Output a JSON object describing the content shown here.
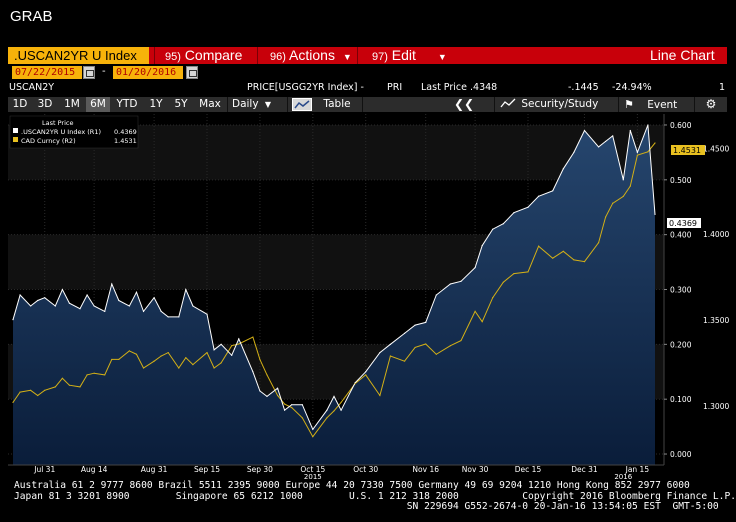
{
  "window": {
    "title": "GRAB"
  },
  "command_bar": {
    "ticker": ".USCAN2YR U Index",
    "compare": {
      "num": "95)",
      "label": "Compare"
    },
    "actions": {
      "num": "96)",
      "label": "Actions"
    },
    "edit": {
      "num": "97)",
      "label": "Edit"
    },
    "view_label": "Line Chart"
  },
  "date_range": {
    "start": "07/22/2015",
    "end": "01/20/2016"
  },
  "info_row": {
    "security": "USCAN2Y",
    "price_field": "PRICE[USGG2YR Index] -",
    "pri": "PRI",
    "last_price": "Last Price .4348",
    "change": "-.1445",
    "change_pct": "-24.94%",
    "page": "1"
  },
  "toolbar": {
    "periods": [
      "1D",
      "3D",
      "1M",
      "6M",
      "YTD",
      "1Y",
      "5Y",
      "Max"
    ],
    "active_period": "6M",
    "frequency": "Daily",
    "table_label": "Table",
    "nav_icon": "double-chevron-left-icon",
    "security_study": "Security/Study",
    "event": "Event",
    "gear_icon": "gear-icon"
  },
  "legend": {
    "header": "Last Price",
    "items": [
      {
        "label": ".USCAN2YR U Index  (R1)",
        "value": "0.4369",
        "color": "#ffffff"
      },
      {
        "label": "CAD Curncy  (R2)",
        "value": "1.4531",
        "color": "#e8c020"
      }
    ]
  },
  "colors": {
    "background": "#000000",
    "area_top": "#26466e",
    "area_bottom": "#0a1d3a",
    "spread_line": "#ffffff",
    "cad_line": "#d4b016",
    "command_bar": "#c8000a",
    "ticker_field": "#f7b20a"
  },
  "chart_data": {
    "type": "line",
    "x_ticks": [
      "Jul 31",
      "Aug 14",
      "Aug 31",
      "Sep 15",
      "Sep 30",
      "Oct 15",
      "Oct 30",
      "Nov 16",
      "Nov 30",
      "Dec 15",
      "Dec 31",
      "Jan 15"
    ],
    "year_labels": [
      "2015",
      "2016"
    ],
    "axis_r1": {
      "ticks": [
        "0.600",
        "0.500",
        "0.400",
        "0.300",
        "0.200",
        "0.100",
        "0.000"
      ],
      "range": [
        -0.02,
        0.62
      ]
    },
    "axis_r2": {
      "ticks": [
        "1.4500",
        "1.4000",
        "1.3500",
        "1.3000"
      ],
      "range": [
        1.2655,
        1.47
      ]
    },
    "last_value_tags": {
      "r1": "0.4369",
      "r2": "1.4531"
    },
    "series": [
      {
        "name": ".USCAN2YR U Index",
        "axis": "R1",
        "x": [
          "2015-07-22",
          "2015-07-24",
          "2015-07-27",
          "2015-07-29",
          "2015-07-31",
          "2015-08-03",
          "2015-08-05",
          "2015-08-07",
          "2015-08-10",
          "2015-08-12",
          "2015-08-14",
          "2015-08-17",
          "2015-08-19",
          "2015-08-21",
          "2015-08-24",
          "2015-08-26",
          "2015-08-28",
          "2015-08-31",
          "2015-09-02",
          "2015-09-04",
          "2015-09-07",
          "2015-09-09",
          "2015-09-11",
          "2015-09-15",
          "2015-09-17",
          "2015-09-19",
          "2015-09-22",
          "2015-09-24",
          "2015-09-28",
          "2015-09-30",
          "2015-10-02",
          "2015-10-05",
          "2015-10-07",
          "2015-10-09",
          "2015-10-12",
          "2015-10-15",
          "2015-10-19",
          "2015-10-21",
          "2015-10-23",
          "2015-10-27",
          "2015-10-30",
          "2015-11-03",
          "2015-11-06",
          "2015-11-10",
          "2015-11-13",
          "2015-11-16",
          "2015-11-19",
          "2015-11-23",
          "2015-11-26",
          "2015-11-30",
          "2015-12-02",
          "2015-12-05",
          "2015-12-08",
          "2015-12-11",
          "2015-12-15",
          "2015-12-18",
          "2015-12-22",
          "2015-12-25",
          "2015-12-28",
          "2015-12-31",
          "2016-01-04",
          "2016-01-06",
          "2016-01-08",
          "2016-01-11",
          "2016-01-13",
          "2016-01-15",
          "2016-01-18",
          "2016-01-20"
        ],
        "values": [
          0.245,
          0.29,
          0.27,
          0.28,
          0.285,
          0.27,
          0.3,
          0.275,
          0.265,
          0.29,
          0.27,
          0.26,
          0.31,
          0.28,
          0.27,
          0.295,
          0.26,
          0.285,
          0.26,
          0.25,
          0.25,
          0.3,
          0.27,
          0.255,
          0.19,
          0.2,
          0.18,
          0.21,
          0.15,
          0.115,
          0.105,
          0.12,
          0.08,
          0.09,
          0.09,
          0.045,
          0.08,
          0.105,
          0.08,
          0.13,
          0.15,
          0.185,
          0.2,
          0.22,
          0.235,
          0.24,
          0.29,
          0.31,
          0.315,
          0.34,
          0.38,
          0.41,
          0.42,
          0.44,
          0.45,
          0.47,
          0.48,
          0.52,
          0.55,
          0.59,
          0.56,
          0.57,
          0.58,
          0.5,
          0.59,
          0.55,
          0.6,
          0.4369
        ]
      },
      {
        "name": "CAD Curncy",
        "axis": "R2",
        "x": [
          "2015-07-22",
          "2015-07-24",
          "2015-07-27",
          "2015-07-29",
          "2015-07-31",
          "2015-08-03",
          "2015-08-05",
          "2015-08-07",
          "2015-08-10",
          "2015-08-12",
          "2015-08-14",
          "2015-08-17",
          "2015-08-19",
          "2015-08-21",
          "2015-08-24",
          "2015-08-26",
          "2015-08-28",
          "2015-08-31",
          "2015-09-02",
          "2015-09-04",
          "2015-09-07",
          "2015-09-09",
          "2015-09-11",
          "2015-09-15",
          "2015-09-17",
          "2015-09-19",
          "2015-09-22",
          "2015-09-24",
          "2015-09-28",
          "2015-09-30",
          "2015-10-02",
          "2015-10-05",
          "2015-10-07",
          "2015-10-09",
          "2015-10-12",
          "2015-10-15",
          "2015-10-19",
          "2015-10-21",
          "2015-10-23",
          "2015-10-27",
          "2015-10-30",
          "2015-11-03",
          "2015-11-06",
          "2015-11-10",
          "2015-11-13",
          "2015-11-16",
          "2015-11-19",
          "2015-11-23",
          "2015-11-26",
          "2015-11-30",
          "2015-12-02",
          "2015-12-05",
          "2015-12-08",
          "2015-12-11",
          "2015-12-15",
          "2015-12-18",
          "2015-12-22",
          "2015-12-25",
          "2015-12-28",
          "2015-12-31",
          "2016-01-04",
          "2016-01-06",
          "2016-01-08",
          "2016-01-11",
          "2016-01-13",
          "2016-01-15",
          "2016-01-18",
          "2016-01-20"
        ],
        "values": [
          1.302,
          1.308,
          1.309,
          1.306,
          1.309,
          1.311,
          1.316,
          1.312,
          1.311,
          1.318,
          1.319,
          1.318,
          1.327,
          1.327,
          1.332,
          1.33,
          1.322,
          1.326,
          1.329,
          1.331,
          1.322,
          1.328,
          1.324,
          1.331,
          1.322,
          1.325,
          1.335,
          1.336,
          1.34,
          1.327,
          1.318,
          1.306,
          1.301,
          1.299,
          1.293,
          1.282,
          1.293,
          1.297,
          1.302,
          1.313,
          1.318,
          1.306,
          1.329,
          1.326,
          1.334,
          1.336,
          1.33,
          1.335,
          1.338,
          1.355,
          1.349,
          1.363,
          1.372,
          1.377,
          1.378,
          1.393,
          1.386,
          1.39,
          1.385,
          1.384,
          1.395,
          1.41,
          1.418,
          1.422,
          1.428,
          1.446,
          1.448,
          1.4531
        ]
      }
    ]
  },
  "footer": {
    "line1": "Australia 61 2 9777 8600 Brazil 5511 2395 9000 Europe 44 20 7330 7500 Germany 49 69 9204 1210 Hong Kong 852 2977 6000",
    "line2": "Japan 81 3 3201 8900        Singapore 65 6212 1000        U.S. 1 212 318 2000           Copyright 2016 Bloomberg Finance L.P.",
    "line3": "                                                                    SN 229694 G552-2674-0 20-Jan-16 13:54:05 EST  GMT-5:00"
  }
}
